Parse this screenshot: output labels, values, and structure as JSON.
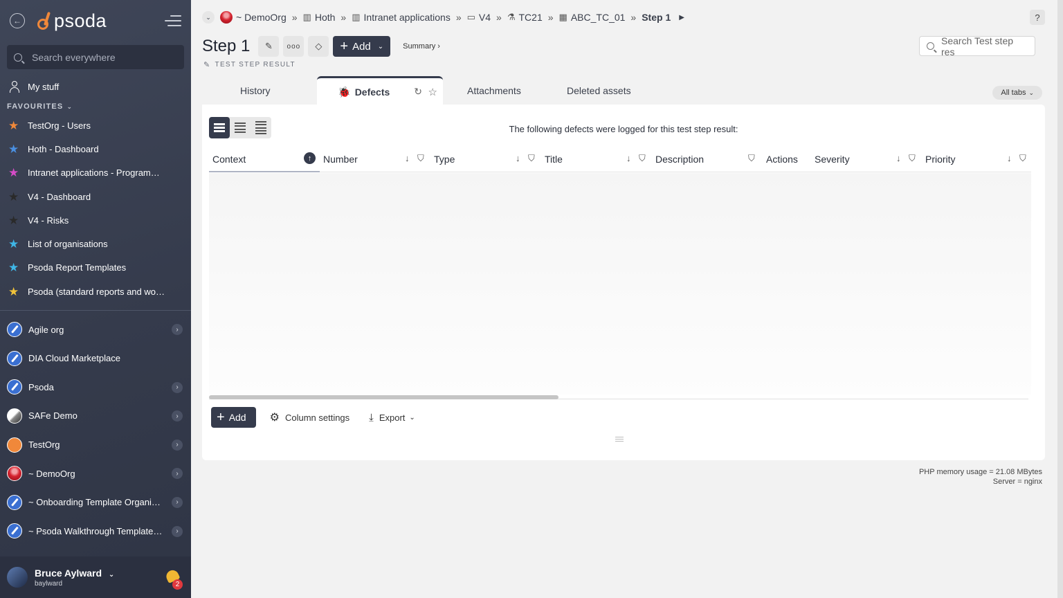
{
  "app": {
    "logo_text": "psoda",
    "brand_color": "#f0883a",
    "dark_color": "#353b4c"
  },
  "sidebar": {
    "search_placeholder": "Search everywhere",
    "my_stuff": "My stuff",
    "favourites_heading": "FAVOURITES",
    "favourites": [
      {
        "label": "TestOrg - Users",
        "star_color": "#f0883a"
      },
      {
        "label": "Hoth - Dashboard",
        "star_color": "#4a8fe0"
      },
      {
        "label": "Intranet applications - Programme…",
        "star_color": "#d54cc7"
      },
      {
        "label": "V4 - Dashboard",
        "star_color": "#2a2a2a"
      },
      {
        "label": "V4 - Risks",
        "star_color": "#2a2a2a"
      },
      {
        "label": "List of organisations",
        "star_color": "#3fb6e6"
      },
      {
        "label": "Psoda Report Templates",
        "star_color": "#3fb6e6"
      },
      {
        "label": "Psoda (standard reports and work…",
        "star_color": "#f0c23a"
      }
    ],
    "orgs": [
      {
        "label": "Agile org",
        "has_chevron": true
      },
      {
        "label": "DIA Cloud Marketplace",
        "has_chevron": false
      },
      {
        "label": "Psoda",
        "has_chevron": true
      },
      {
        "label": "SAFe Demo",
        "has_chevron": true
      },
      {
        "label": "TestOrg",
        "has_chevron": true
      },
      {
        "label": "~ DemoOrg",
        "has_chevron": true
      },
      {
        "label": "~ Onboarding Template Organisa…",
        "has_chevron": true
      },
      {
        "label": "~ Psoda Walkthrough Template P…",
        "has_chevron": true
      }
    ],
    "user": {
      "name": "Bruce Aylward",
      "handle": "baylward",
      "notifications": "2"
    }
  },
  "breadcrumb": {
    "items": [
      {
        "label": "~ DemoOrg",
        "icon": "org-logo-icon"
      },
      {
        "label": "Hoth",
        "icon": "programme-icon"
      },
      {
        "label": "Intranet applications",
        "icon": "programme-icon"
      },
      {
        "label": "V4",
        "icon": "project-icon"
      },
      {
        "label": "TC21",
        "icon": "test-case-icon"
      },
      {
        "label": "ABC_TC_01",
        "icon": "test-run-icon"
      },
      {
        "label": "Step 1",
        "icon": ""
      }
    ],
    "help_label": "?"
  },
  "header": {
    "title": "Step 1",
    "subtitle": "TEST STEP RESULT",
    "add_label": "Add",
    "summary_label": "Summary ›",
    "search_placeholder": "Search Test step res"
  },
  "tabs": {
    "history": "History",
    "defects": "Defects",
    "attachments": "Attachments",
    "deleted": "Deleted assets",
    "all_tabs": "All tabs"
  },
  "panel": {
    "intro": "The following defects were logged for this test step result:",
    "columns": [
      "Context",
      "Number",
      "Type",
      "Title",
      "Description",
      "Actions",
      "Severity",
      "Priority"
    ],
    "rows": [],
    "footer": {
      "add_label": "Add",
      "column_settings_label": "Column settings",
      "export_label": "Export"
    }
  },
  "server_info": {
    "memory": "PHP memory usage = 21.08 MBytes",
    "server": "Server = nginx"
  }
}
